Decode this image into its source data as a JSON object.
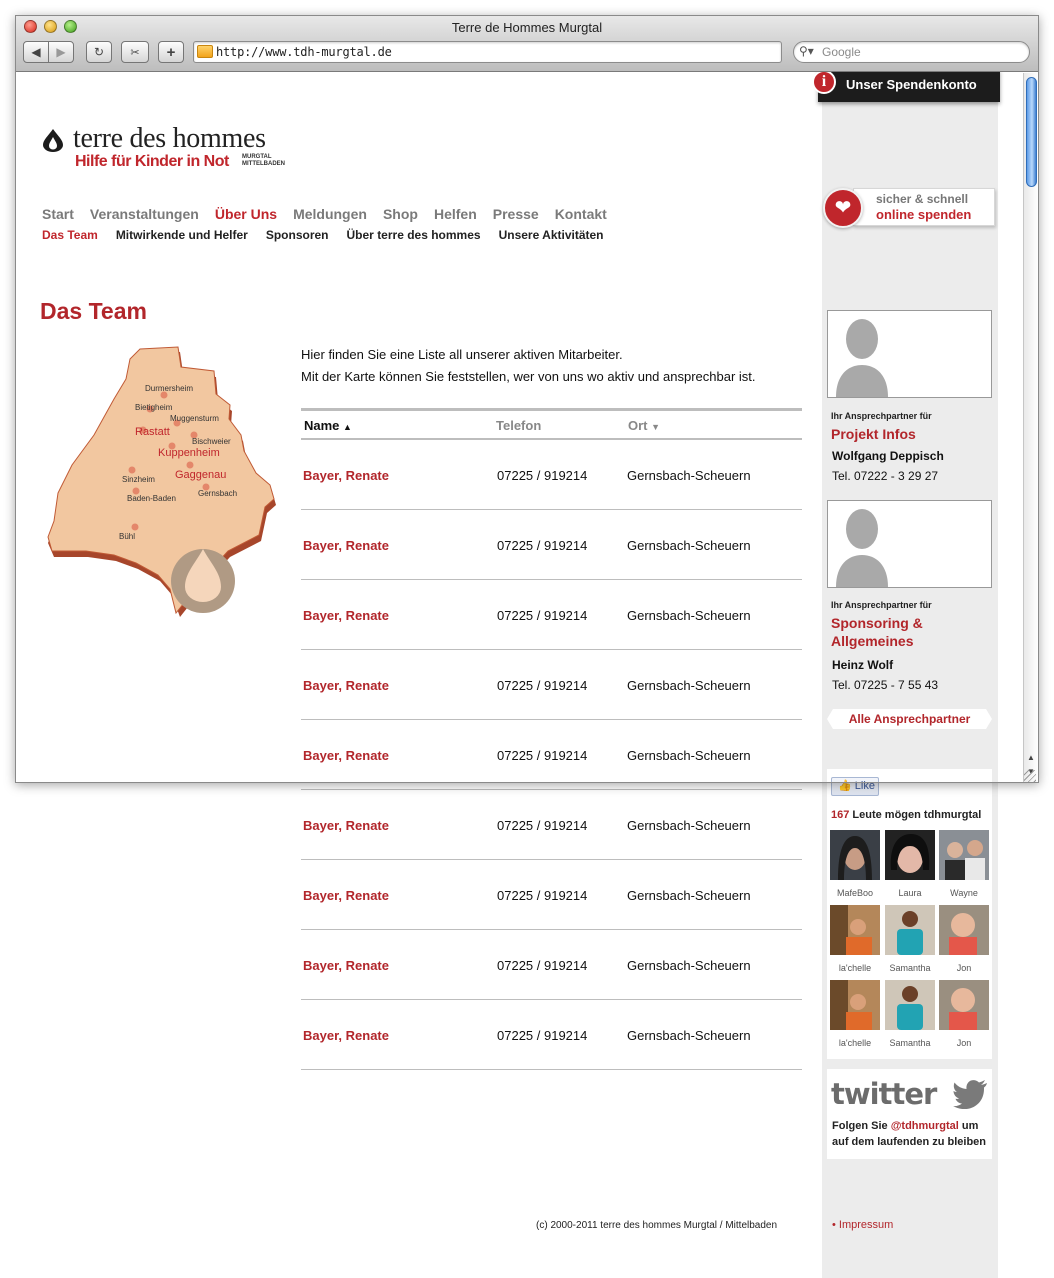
{
  "browser": {
    "window_title": "Terre de Hommes Murgtal",
    "url": "http://www.tdh-murgtal.de",
    "search_placeholder": "Google"
  },
  "header": {
    "spendenkonto": "Unser Spendenkonto",
    "logo_title": "terre des hommes",
    "logo_tagline": "Hilfe für Kinder in Not",
    "logo_region_1": "MURGTAL",
    "logo_region_2": "MITTELBADEN"
  },
  "nav": {
    "items": [
      "Start",
      "Veranstaltungen",
      "Über Uns",
      "Meldungen",
      "Shop",
      "Helfen",
      "Presse",
      "Kontakt"
    ],
    "active": "Über Uns",
    "sub_items": [
      "Das Team",
      "Mitwirkende und Helfer",
      "Sponsoren",
      "Über terre des hommes",
      "Unsere Aktivitäten"
    ],
    "sub_active": "Das Team"
  },
  "donate": {
    "line1": "sicher & schnell",
    "line2": "online spenden"
  },
  "main": {
    "title": "Das Team",
    "intro_1": "Hier finden Sie eine Liste all unserer aktiven Mitarbeiter.",
    "intro_2": "Mit der Karte können Sie feststellen, wer von uns wo aktiv und ansprechbar ist."
  },
  "map": {
    "places": [
      "Durmersheim",
      "Bietigheim",
      "Muggensturm",
      "Rastatt",
      "Bischweier",
      "Kuppenheim",
      "Gaggenau",
      "Sinzheim",
      "Gernsbach",
      "Baden-Baden",
      "Bühl"
    ]
  },
  "table": {
    "headers": {
      "name": "Name",
      "phone": "Telefon",
      "ort": "Ort"
    },
    "rows": [
      {
        "name": "Bayer, Renate",
        "phone": "07225 / 919214",
        "ort": "Gernsbach-Scheuern"
      },
      {
        "name": "Bayer, Renate",
        "phone": "07225 / 919214",
        "ort": "Gernsbach-Scheuern"
      },
      {
        "name": "Bayer, Renate",
        "phone": "07225 / 919214",
        "ort": "Gernsbach-Scheuern"
      },
      {
        "name": "Bayer, Renate",
        "phone": "07225 / 919214",
        "ort": "Gernsbach-Scheuern"
      },
      {
        "name": "Bayer, Renate",
        "phone": "07225 / 919214",
        "ort": "Gernsbach-Scheuern"
      },
      {
        "name": "Bayer, Renate",
        "phone": "07225 / 919214",
        "ort": "Gernsbach-Scheuern"
      },
      {
        "name": "Bayer, Renate",
        "phone": "07225 / 919214",
        "ort": "Gernsbach-Scheuern"
      },
      {
        "name": "Bayer, Renate",
        "phone": "07225 / 919214",
        "ort": "Gernsbach-Scheuern"
      },
      {
        "name": "Bayer, Renate",
        "phone": "07225 / 919214",
        "ort": "Gernsbach-Scheuern"
      }
    ]
  },
  "contacts": [
    {
      "intro": "Ihr Ansprechpartner für",
      "topic_1": "Projekt Infos",
      "topic_2": "",
      "name": "Wolfgang Deppisch",
      "tel": "Tel. 07222 - 3 29 27"
    },
    {
      "intro": "Ihr Ansprechpartner für",
      "topic_1": "Sponsoring &",
      "topic_2": "Allgemeines",
      "name": "Heinz Wolf",
      "tel": "Tel. 07225 - 7 55 43"
    }
  ],
  "all_contacts_link": "Alle Ansprechpartner",
  "facebook": {
    "like_label": "Like",
    "count": "167",
    "count_suffix": " Leute mögen tdhmurgtal",
    "fans": [
      "MafeBoo",
      "Laura",
      "Wayne",
      "la'chelle",
      "Samantha",
      "Jon",
      "la'chelle",
      "Samantha",
      "Jon"
    ]
  },
  "twitter": {
    "logo": "twitter",
    "text_prefix": "Folgen Sie ",
    "handle": "@tdhmurgtal",
    "text_suffix": " um auf dem laufenden zu bleiben"
  },
  "footer": {
    "copyright": "(c) 2000-2011 terre des hommes Murgtal / Mittelbaden",
    "impressum": "• Impressum"
  },
  "colors": {
    "brand_red": "#b2262b",
    "sidebar_gray": "#ececec",
    "map_fill": "#f2c7a0"
  }
}
